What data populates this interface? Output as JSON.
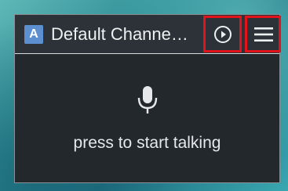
{
  "header": {
    "app_badge": "A",
    "channel_title": "Default Channe…"
  },
  "buttons": {
    "play_icon": "play-circle-icon",
    "menu_icon": "hamburger-menu-icon"
  },
  "talk": {
    "icon": "microphone-icon",
    "label": "press to start talking"
  },
  "colors": {
    "panel": "#23282d",
    "header": "#2c3237",
    "highlight": "#e0141a",
    "badge": "#5c8fd0"
  }
}
